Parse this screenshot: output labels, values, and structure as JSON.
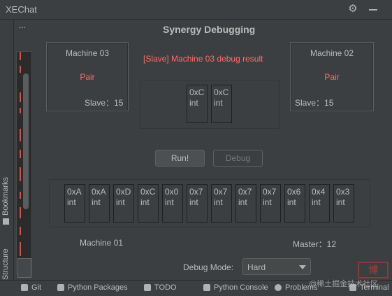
{
  "window": {
    "title": "XEChat"
  },
  "left_stripe": {
    "bookmarks_label": "Bookmarks",
    "structure_label": "Structure"
  },
  "structure_panel": {
    "menu": "..."
  },
  "panel": {
    "heading": "Synergy Debugging",
    "machine_03": {
      "name": "Machine 03",
      "status": "Pair",
      "role": "Slave：15"
    },
    "machine_02": {
      "name": "Machine 02",
      "status": "Pair",
      "role": "Slave：15"
    },
    "result_text": "[Slave] Machine 03 debug result",
    "slave_registers": [
      {
        "value": "0xC",
        "type": "int"
      },
      {
        "value": "0xC",
        "type": "int"
      }
    ],
    "buttons": {
      "run": "Run!",
      "debug": "Debug"
    },
    "master_registers": [
      {
        "value": "0xA",
        "type": "int"
      },
      {
        "value": "0xA",
        "type": "int"
      },
      {
        "value": "0xD",
        "type": "int"
      },
      {
        "value": "0xC",
        "type": "int"
      },
      {
        "value": "0x0",
        "type": "int"
      },
      {
        "value": "0x7",
        "type": "int"
      },
      {
        "value": "0x7",
        "type": "int"
      },
      {
        "value": "0x7",
        "type": "int"
      },
      {
        "value": "0x7",
        "type": "int"
      },
      {
        "value": "0x6",
        "type": "int"
      },
      {
        "value": "0x4",
        "type": "int"
      },
      {
        "value": "0x3",
        "type": "int"
      }
    ],
    "machine_01": "Machine 01",
    "master_label": "Master：12",
    "debug_mode_label": "Debug Mode:",
    "debug_mode_value": "Hard"
  },
  "bottom_bar": {
    "git": "Git",
    "python_packages": "Python Packages",
    "todo": "TODO",
    "python_console": "Python Console",
    "problems": "Problems",
    "terminal": "Terminal"
  },
  "watermark": {
    "text": "@稀土掘金技术社区",
    "badge": "博"
  },
  "colors": {
    "accent_red": "#ff6b68",
    "background": "#3c3f41",
    "text": "#bbbbbb"
  }
}
